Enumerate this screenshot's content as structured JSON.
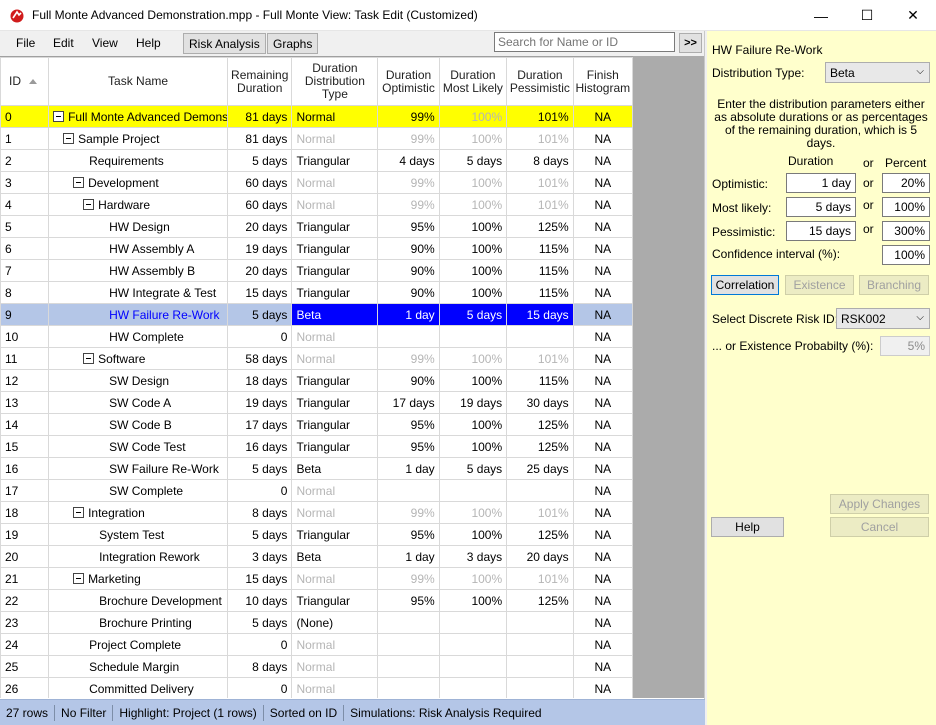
{
  "window": {
    "title": "Full Monte Advanced Demonstration.mpp - Full Monte View: Task Edit (Customized)",
    "minimize_glyph": "—",
    "maximize_glyph": "☐",
    "close_glyph": "✕",
    "icon": "app-logo-icon"
  },
  "menu": {
    "file": "File",
    "edit": "Edit",
    "view": "View",
    "help": "Help",
    "risk_analysis": "Risk Analysis",
    "graphs": "Graphs"
  },
  "search": {
    "placeholder": "Search for Name or ID",
    "go_label": ">>"
  },
  "grid": {
    "columns": {
      "id": "ID",
      "name": "Task Name",
      "remaining": "Remaining Duration",
      "dist_type": "Duration Distribution Type",
      "optimistic": "Duration Optimistic",
      "most_likely": "Duration Most Likely",
      "pessimistic": "Duration Pessimistic",
      "histogram": "Finish Histogram"
    },
    "rows": [
      {
        "id": "0",
        "name": "Full Monte Advanced Demonst",
        "level": 0,
        "summary": true,
        "rem": "81 days",
        "type": "Normal",
        "opt": "99%",
        "ml": "100%",
        "pes": "101%",
        "hist": "NA",
        "gray": false,
        "mlgray": true,
        "hl": "yellow"
      },
      {
        "id": "1",
        "name": "Sample Project",
        "level": 1,
        "summary": true,
        "rem": "81 days",
        "type": "Normal",
        "opt": "99%",
        "ml": "100%",
        "pes": "101%",
        "hist": "NA",
        "gray": true
      },
      {
        "id": "2",
        "name": "Requirements",
        "level": 2,
        "summary": false,
        "rem": "5 days",
        "type": "Triangular",
        "opt": "4 days",
        "ml": "5 days",
        "pes": "8 days",
        "hist": "NA",
        "gray": false
      },
      {
        "id": "3",
        "name": "Development",
        "level": 2,
        "summary": true,
        "rem": "60 days",
        "type": "Normal",
        "opt": "99%",
        "ml": "100%",
        "pes": "101%",
        "hist": "NA",
        "gray": true
      },
      {
        "id": "4",
        "name": "Hardware",
        "level": 3,
        "summary": true,
        "rem": "60 days",
        "type": "Normal",
        "opt": "99%",
        "ml": "100%",
        "pes": "101%",
        "hist": "NA",
        "gray": true
      },
      {
        "id": "5",
        "name": "HW Design",
        "level": 4,
        "summary": false,
        "rem": "20 days",
        "type": "Triangular",
        "opt": "95%",
        "ml": "100%",
        "pes": "125%",
        "hist": "NA",
        "gray": false
      },
      {
        "id": "6",
        "name": "HW Assembly A",
        "level": 4,
        "summary": false,
        "rem": "19 days",
        "type": "Triangular",
        "opt": "90%",
        "ml": "100%",
        "pes": "115%",
        "hist": "NA",
        "gray": false
      },
      {
        "id": "7",
        "name": "HW Assembly B",
        "level": 4,
        "summary": false,
        "rem": "20 days",
        "type": "Triangular",
        "opt": "90%",
        "ml": "100%",
        "pes": "115%",
        "hist": "NA",
        "gray": false
      },
      {
        "id": "8",
        "name": "HW Integrate & Test",
        "level": 4,
        "summary": false,
        "rem": "15 days",
        "type": "Triangular",
        "opt": "90%",
        "ml": "100%",
        "pes": "115%",
        "hist": "NA",
        "gray": false
      },
      {
        "id": "9",
        "name": "HW Failure Re-Work",
        "level": 4,
        "summary": false,
        "rem": "5 days",
        "type": "Beta",
        "opt": "1 day",
        "ml": "5 days",
        "pes": "15 days",
        "hist": "NA",
        "gray": false,
        "hl": "sel"
      },
      {
        "id": "10",
        "name": "HW Complete",
        "level": 4,
        "summary": false,
        "rem": "0",
        "type": "Normal",
        "opt": "",
        "ml": "",
        "pes": "",
        "hist": "NA",
        "gray": true
      },
      {
        "id": "11",
        "name": "Software",
        "level": 3,
        "summary": true,
        "rem": "58 days",
        "type": "Normal",
        "opt": "99%",
        "ml": "100%",
        "pes": "101%",
        "hist": "NA",
        "gray": true
      },
      {
        "id": "12",
        "name": "SW Design",
        "level": 4,
        "summary": false,
        "rem": "18 days",
        "type": "Triangular",
        "opt": "90%",
        "ml": "100%",
        "pes": "115%",
        "hist": "NA",
        "gray": false
      },
      {
        "id": "13",
        "name": "SW Code A",
        "level": 4,
        "summary": false,
        "rem": "19 days",
        "type": "Triangular",
        "opt": "17 days",
        "ml": "19 days",
        "pes": "30 days",
        "hist": "NA",
        "gray": false
      },
      {
        "id": "14",
        "name": "SW Code B",
        "level": 4,
        "summary": false,
        "rem": "17 days",
        "type": "Triangular",
        "opt": "95%",
        "ml": "100%",
        "pes": "125%",
        "hist": "NA",
        "gray": false
      },
      {
        "id": "15",
        "name": "SW Code Test",
        "level": 4,
        "summary": false,
        "rem": "16 days",
        "type": "Triangular",
        "opt": "95%",
        "ml": "100%",
        "pes": "125%",
        "hist": "NA",
        "gray": false
      },
      {
        "id": "16",
        "name": "SW Failure Re-Work",
        "level": 4,
        "summary": false,
        "rem": "5 days",
        "type": "Beta",
        "opt": "1 day",
        "ml": "5 days",
        "pes": "25 days",
        "hist": "NA",
        "gray": false
      },
      {
        "id": "17",
        "name": "SW Complete",
        "level": 4,
        "summary": false,
        "rem": "0",
        "type": "Normal",
        "opt": "",
        "ml": "",
        "pes": "",
        "hist": "NA",
        "gray": true
      },
      {
        "id": "18",
        "name": "Integration",
        "level": 2,
        "summary": true,
        "rem": "8 days",
        "type": "Normal",
        "opt": "99%",
        "ml": "100%",
        "pes": "101%",
        "hist": "NA",
        "gray": true
      },
      {
        "id": "19",
        "name": "System Test",
        "level": 3,
        "summary": false,
        "rem": "5 days",
        "type": "Triangular",
        "opt": "95%",
        "ml": "100%",
        "pes": "125%",
        "hist": "NA",
        "gray": false
      },
      {
        "id": "20",
        "name": "Integration Rework",
        "level": 3,
        "summary": false,
        "rem": "3 days",
        "type": "Beta",
        "opt": "1 day",
        "ml": "3 days",
        "pes": "20 days",
        "hist": "NA",
        "gray": false
      },
      {
        "id": "21",
        "name": "Marketing",
        "level": 2,
        "summary": true,
        "rem": "15 days",
        "type": "Normal",
        "opt": "99%",
        "ml": "100%",
        "pes": "101%",
        "hist": "NA",
        "gray": true
      },
      {
        "id": "22",
        "name": "Brochure Development",
        "level": 3,
        "summary": false,
        "rem": "10 days",
        "type": "Triangular",
        "opt": "95%",
        "ml": "100%",
        "pes": "125%",
        "hist": "NA",
        "gray": false
      },
      {
        "id": "23",
        "name": "Brochure Printing",
        "level": 3,
        "summary": false,
        "rem": "5 days",
        "type": "(None)",
        "opt": "",
        "ml": "",
        "pes": "",
        "hist": "NA",
        "gray": false
      },
      {
        "id": "24",
        "name": "Project Complete",
        "level": 2,
        "summary": false,
        "rem": "0",
        "type": "Normal",
        "opt": "",
        "ml": "",
        "pes": "",
        "hist": "NA",
        "gray": true
      },
      {
        "id": "25",
        "name": "Schedule Margin",
        "level": 2,
        "summary": false,
        "rem": "8 days",
        "type": "Normal",
        "opt": "",
        "ml": "",
        "pes": "",
        "hist": "NA",
        "gray": true
      },
      {
        "id": "26",
        "name": "Committed Delivery",
        "level": 2,
        "summary": false,
        "rem": "0",
        "type": "Normal",
        "opt": "",
        "ml": "",
        "pes": "",
        "hist": "NA",
        "gray": true
      }
    ]
  },
  "status": {
    "rows": "27 rows",
    "filter": "No Filter",
    "highlight": "Highlight: Project (1 rows)",
    "sort": "Sorted on ID",
    "simulations": "Simulations: Risk Analysis Required"
  },
  "panel": {
    "task_name": "HW Failure Re-Work",
    "dist_type_label": "Distribution Type:",
    "dist_type_value": "Beta",
    "instructions": "Enter the distribution parameters either as absolute durations or as percentages of the remaining duration, which is 5 days.",
    "col_duration": "Duration",
    "col_or": "or",
    "col_percent": "Percent",
    "optimistic_label": "Optimistic:",
    "optimistic_dur": "1 day",
    "optimistic_pct": "20%",
    "most_likely_label": "Most likely:",
    "most_likely_dur": "5 days",
    "most_likely_pct": "100%",
    "pessimistic_label": "Pessimistic:",
    "pessimistic_dur": "15 days",
    "pessimistic_pct": "300%",
    "ci_label": "Confidence interval (%):",
    "ci_value": "100%",
    "or_word": "or",
    "correlation_btn": "Correlation",
    "existence_btn": "Existence",
    "branching_btn": "Branching",
    "risk_id_label": "Select Discrete Risk ID:",
    "risk_id_value": "RSK002",
    "existence_prob_label": "... or Existence Probabilty (%):",
    "existence_prob_value": "5%",
    "apply_btn": "Apply Changes",
    "help_btn": "Help",
    "cancel_btn": "Cancel"
  },
  "colors": {
    "highlight_yellow": "#ffff00",
    "selection_row": "#b4c6e7",
    "selection_cell": "#0000ff",
    "panel_bg": "#ffffcc",
    "status_bg": "#b4c6e7"
  }
}
